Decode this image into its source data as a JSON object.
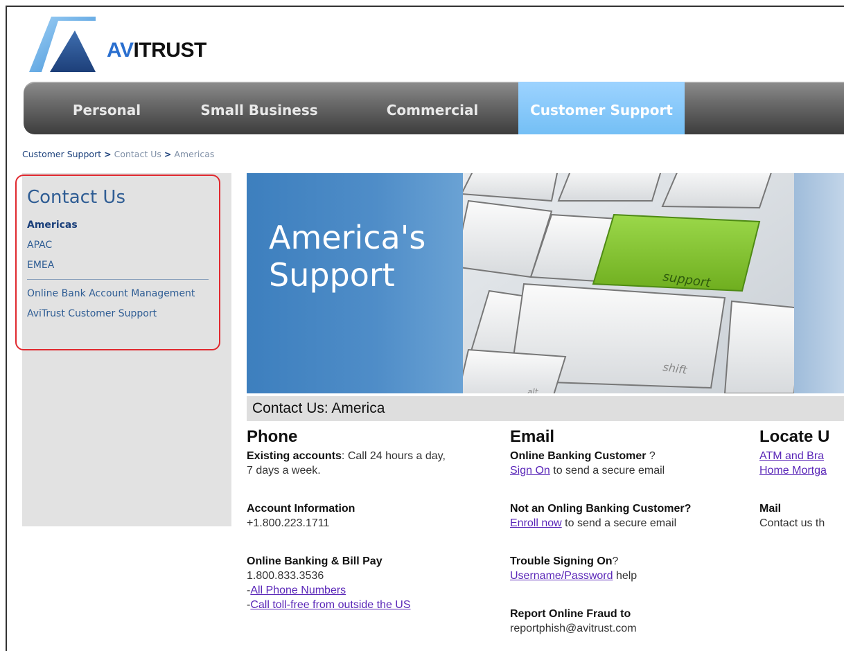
{
  "logo": {
    "av": "AV",
    "rest": "ITRUST"
  },
  "nav": [
    {
      "label": "Personal",
      "active": false
    },
    {
      "label": "Small Business",
      "active": false
    },
    {
      "label": "Commercial",
      "active": false
    },
    {
      "label": "Customer Support",
      "active": true
    }
  ],
  "breadcrumb": {
    "item1": "Customer Support",
    "sep": ">",
    "item2": "Contact Us",
    "item3": "Americas"
  },
  "sidebar": {
    "title": "Contact Us",
    "links": [
      "Americas",
      "APAC",
      "EMEA"
    ],
    "links2": [
      "Online Bank Account Management",
      "AviTrust Customer Support"
    ]
  },
  "banner": {
    "title": "America's\nSupport",
    "key_label": "support",
    "shift_label": "shift",
    "alt_label": "alt"
  },
  "section": {
    "title": "Contact Us: America"
  },
  "phone": {
    "heading": "Phone",
    "existing_bold": "Existing accounts",
    "existing_text": ": Call 24 hours a day,",
    "existing_text2": "7 days a week.",
    "acct_title": "Account Information",
    "acct_number": "+1.800.223.1711",
    "obbp_title": "Online Banking & Bill Pay",
    "obbp_number": "1.800.833.3536",
    "dash": "-",
    "link_all": "All Phone Numbers",
    "link_tollfree": "Call toll-free from outside the US"
  },
  "email": {
    "heading": "Email",
    "obc_bold": "Online Banking Customer",
    "obc_q": " ?",
    "signon_link": "Sign On",
    "signon_text": " to send a secure email",
    "not_title": "Not an Onling Banking Customer?",
    "enroll_link": "Enroll now",
    "enroll_text": " to send a secure email",
    "trouble_bold": "Trouble Signing On",
    "trouble_q": "?",
    "userpass_link": "Username/Password",
    "userpass_text": " help",
    "fraud_title": "Report Online Fraud to",
    "fraud_email": "reportphish@avitrust.com"
  },
  "locate": {
    "heading": "Locate U",
    "atm_link": "ATM and Bra",
    "mort_link": "Home Mortga",
    "mail_title": "Mail",
    "mail_text": "Contact us th"
  },
  "colors": {
    "nav_active": "#74bff5",
    "link": "#5a27b8",
    "sidebar_link": "#2f5d94",
    "highlight_border": "#e0292f"
  }
}
